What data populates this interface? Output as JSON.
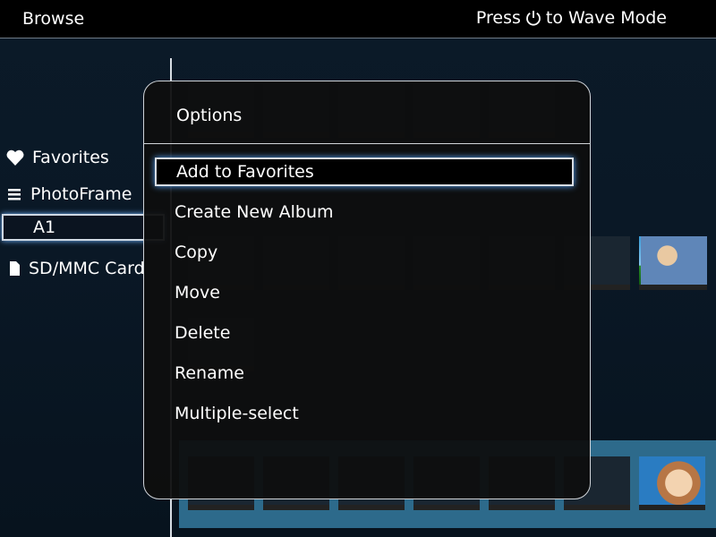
{
  "topbar": {
    "title": "Browse",
    "hint_prefix": "Press",
    "hint_suffix": "to Wave Mode",
    "hint_icon": "power-icon"
  },
  "sidebar": {
    "items": [
      {
        "label": "Favorites",
        "icon": "heart-icon"
      },
      {
        "label": "PhotoFrame",
        "icon": "list-icon"
      },
      {
        "label": "A1",
        "icon": ""
      },
      {
        "label": "SD/MMC Card",
        "icon": "card-icon"
      }
    ]
  },
  "modal": {
    "title": "Options",
    "options": [
      {
        "label": "Add to Favorites",
        "selected": true
      },
      {
        "label": "Create New Album"
      },
      {
        "label": "Copy"
      },
      {
        "label": "Move"
      },
      {
        "label": "Delete"
      },
      {
        "label": "Rename"
      },
      {
        "label": "Multiple-select"
      }
    ]
  },
  "colors": {
    "accent_glow": "#5aa8ff",
    "panel_blue": "#2d6a8b"
  }
}
